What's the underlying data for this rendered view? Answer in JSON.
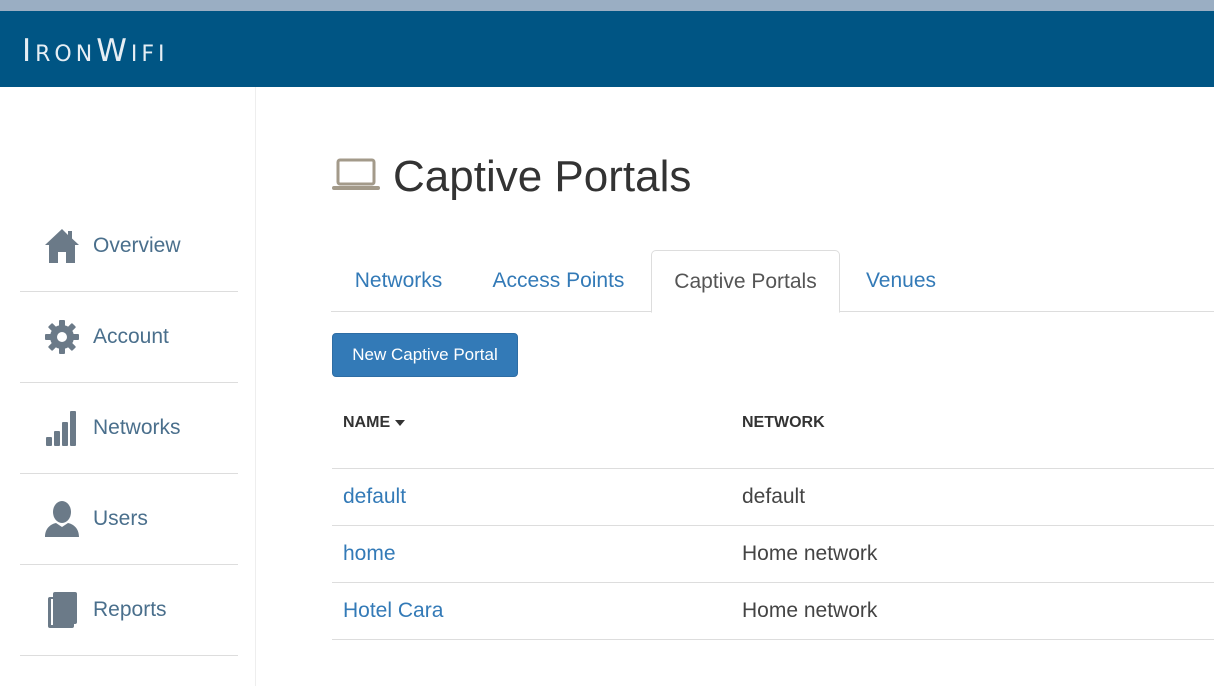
{
  "header": {
    "logo_text": "IronWifi"
  },
  "sidebar": {
    "items": [
      {
        "label": "Overview",
        "icon": "home-icon"
      },
      {
        "label": "Account",
        "icon": "gear-icon"
      },
      {
        "label": "Networks",
        "icon": "signal-bars-icon"
      },
      {
        "label": "Users",
        "icon": "user-icon"
      },
      {
        "label": "Reports",
        "icon": "book-icon"
      }
    ]
  },
  "page": {
    "title": "Captive Portals",
    "title_icon": "laptop-icon"
  },
  "tabs": [
    {
      "label": "Networks",
      "active": false
    },
    {
      "label": "Access Points",
      "active": false
    },
    {
      "label": "Captive Portals",
      "active": true
    },
    {
      "label": "Venues",
      "active": false
    }
  ],
  "actions": {
    "new_button": "New Captive Portal"
  },
  "table": {
    "columns": [
      "NAME",
      "NETWORK"
    ],
    "sort_indicator": "caret-down-icon",
    "rows": [
      {
        "name": "default",
        "network": "default"
      },
      {
        "name": "home",
        "network": "Home network"
      },
      {
        "name": "Hotel Cara",
        "network": "Home network"
      }
    ]
  },
  "colors": {
    "header_bg": "#005584",
    "link": "#337ab7",
    "primary_button": "#337ab7"
  }
}
